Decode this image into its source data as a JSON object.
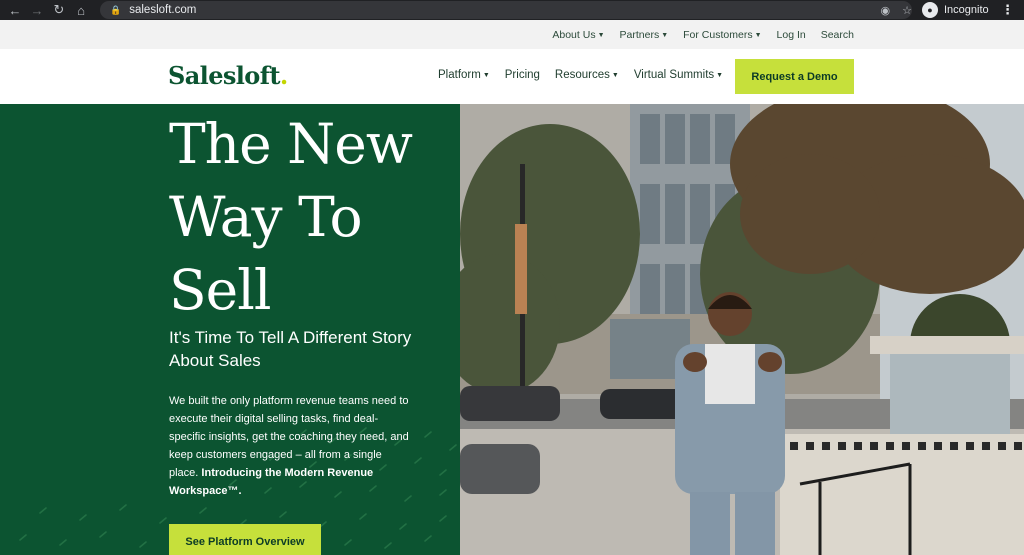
{
  "browser": {
    "url": "salesloft.com",
    "profile_label": "Incognito",
    "icons": [
      "back-icon",
      "forward-icon",
      "reload-icon",
      "home-icon",
      "lock-icon",
      "eye-off-icon",
      "star-icon",
      "incognito-icon",
      "kebab-menu-icon"
    ]
  },
  "utility_nav": {
    "items": [
      {
        "label": "About Us",
        "dropdown": true
      },
      {
        "label": "Partners",
        "dropdown": true
      },
      {
        "label": "For Customers",
        "dropdown": true
      },
      {
        "label": "Log In",
        "dropdown": false
      },
      {
        "label": "Search",
        "dropdown": false
      }
    ]
  },
  "main_nav": {
    "logo_text": "Salesloft",
    "logo_dot": ".",
    "items": [
      {
        "label": "Platform",
        "dropdown": true
      },
      {
        "label": "Pricing",
        "dropdown": false
      },
      {
        "label": "Resources",
        "dropdown": true
      },
      {
        "label": "Virtual Summits",
        "dropdown": true
      }
    ],
    "cta_label": "Request a Demo"
  },
  "hero": {
    "headline_lines": [
      "The New",
      "Way To",
      "Sell"
    ],
    "subhead": "It's Time To Tell A Different Story About Sales",
    "body": "We built the only platform revenue teams need to execute their digital selling tasks, find deal-specific insights, get the coaching they need, and keep customers engaged – all from a single place.",
    "body_bold": "Introducing the Modern Revenue Workspace™.",
    "cta_label": "See Platform Overview"
  },
  "colors": {
    "brand_green": "#0c5431",
    "accent_lime": "#c6e03b",
    "utility_bg": "#f2f2f2",
    "chrome_bg": "#202124"
  }
}
